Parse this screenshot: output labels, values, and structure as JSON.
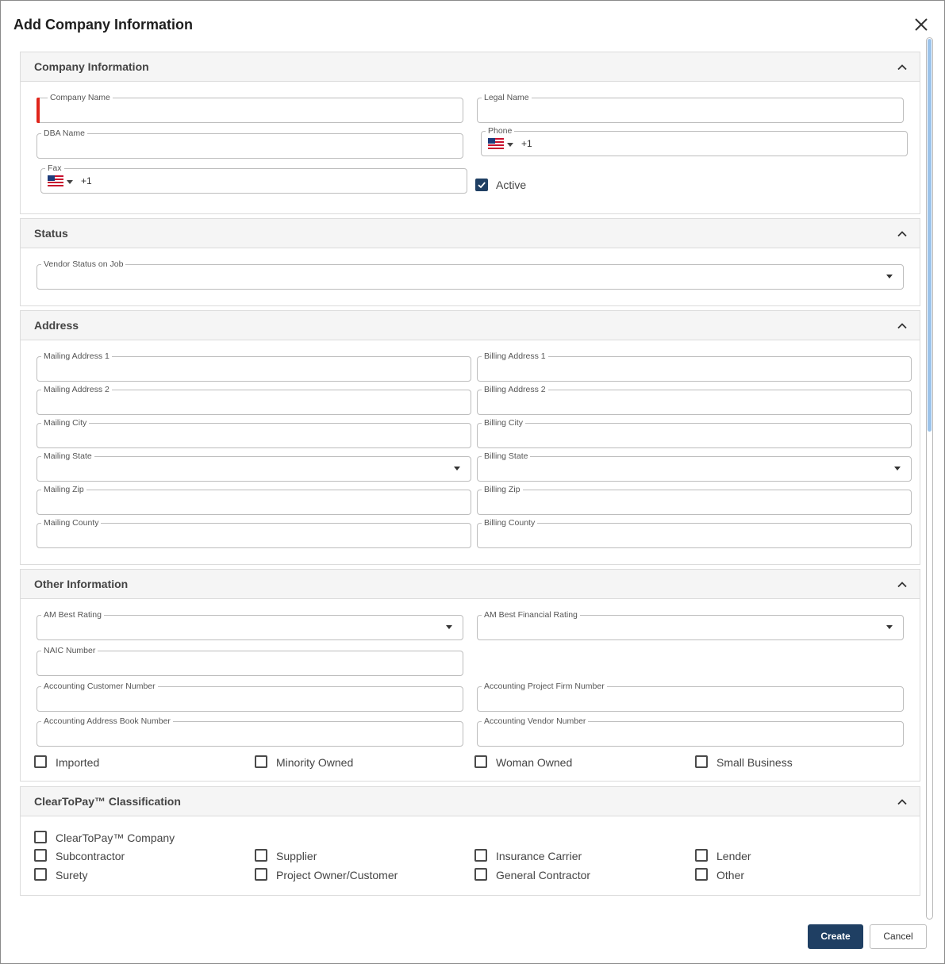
{
  "dialog": {
    "title": "Add Company Information"
  },
  "sections": {
    "company": {
      "title": "Company Information",
      "company_name": "Company Name",
      "legal_name": "Legal Name",
      "dba_name": "DBA Name",
      "phone": "Phone",
      "phone_code": "+1",
      "fax": "Fax",
      "fax_code": "+1",
      "active": "Active"
    },
    "status": {
      "title": "Status",
      "vendor_status": "Vendor Status on Job"
    },
    "address": {
      "title": "Address",
      "mailing_address_1": "Mailing Address 1",
      "mailing_address_2": "Mailing Address 2",
      "mailing_city": "Mailing City",
      "mailing_state": "Mailing State",
      "mailing_zip": "Mailing Zip",
      "mailing_county": "Mailing County",
      "billing_address_1": "Billing Address 1",
      "billing_address_2": "Billing Address 2",
      "billing_city": "Billing City",
      "billing_state": "Billing State",
      "billing_zip": "Billing Zip",
      "billing_county": "Billing County"
    },
    "other": {
      "title": "Other Information",
      "am_best_rating": "AM Best Rating",
      "am_best_financial_rating": "AM Best Financial Rating",
      "naic_number": "NAIC Number",
      "accounting_customer_number": "Accounting Customer Number",
      "accounting_project_firm_number": "Accounting Project Firm Number",
      "accounting_address_book_number": "Accounting Address Book Number",
      "accounting_vendor_number": "Accounting Vendor Number",
      "imported": "Imported",
      "minority_owned": "Minority Owned",
      "woman_owned": "Woman Owned",
      "small_business": "Small Business"
    },
    "ctp": {
      "title": "ClearToPay™ Classification",
      "ctp_company": "ClearToPay™ Company",
      "subcontractor": "Subcontractor",
      "supplier": "Supplier",
      "insurance_carrier": "Insurance Carrier",
      "lender": "Lender",
      "surety": "Surety",
      "project_owner": "Project Owner/Customer",
      "general_contractor": "General Contractor",
      "other": "Other"
    }
  },
  "buttons": {
    "create": "Create",
    "cancel": "Cancel"
  },
  "state": {
    "active_checked": true
  },
  "icons": {
    "close": "close-icon",
    "collapse": "chevron-up-icon",
    "flag": "us-flag-icon",
    "dropdown": "caret-down-icon",
    "check": "check-icon"
  },
  "colors": {
    "primary": "#1f3f63",
    "required": "#e0251b",
    "scrollbar": "#9cc3ea"
  }
}
